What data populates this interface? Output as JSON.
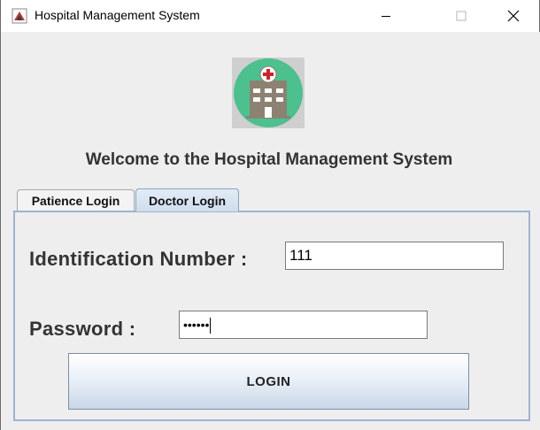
{
  "window": {
    "title": "Hospital Management System",
    "minimize_icon": "minimize-icon",
    "maximize_icon": "maximize-icon",
    "close_icon": "close-icon"
  },
  "header": {
    "logo_icon": "hospital-icon",
    "welcome": "Welcome to the Hospital Management System"
  },
  "tabs": [
    {
      "label": "Patience Login",
      "selected": false
    },
    {
      "label": "Doctor Login",
      "selected": true
    }
  ],
  "form": {
    "id_label": "Identification Number :",
    "id_value": "111",
    "password_label": "Password :",
    "password_value": "••••••",
    "login_label": "LOGIN"
  },
  "colors": {
    "background": "#eeeeee",
    "tab_border": "#9db4d2",
    "logo_circle": "#4cc08e",
    "logo_building": "#8d8172",
    "logo_cross": "#d0222a"
  }
}
